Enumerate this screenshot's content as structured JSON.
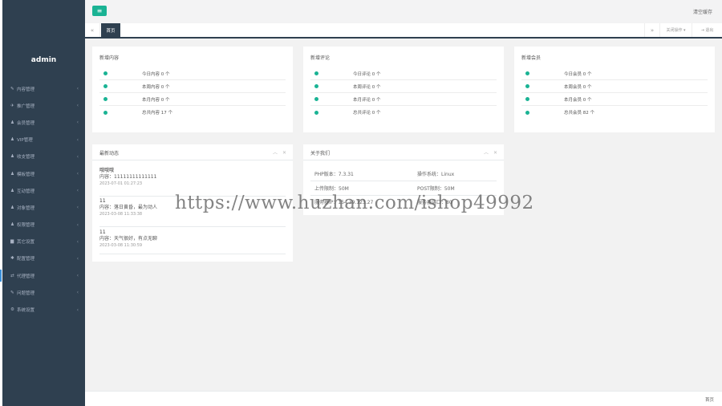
{
  "brand": "admin",
  "sidebar": {
    "items": [
      {
        "icon": "edit-icon",
        "glyph": "✎",
        "label": "内容管理"
      },
      {
        "icon": "send-icon",
        "glyph": "✈",
        "label": "推广管理"
      },
      {
        "icon": "user-icon",
        "glyph": "♟",
        "label": "会员管理"
      },
      {
        "icon": "user-icon",
        "glyph": "♟",
        "label": "VIP管理"
      },
      {
        "icon": "user-icon",
        "glyph": "♟",
        "label": "收支管理"
      },
      {
        "icon": "user-icon",
        "glyph": "♟",
        "label": "模板管理"
      },
      {
        "icon": "user-icon",
        "glyph": "♟",
        "label": "互动管理"
      },
      {
        "icon": "user-icon",
        "glyph": "♟",
        "label": "对象管理"
      },
      {
        "icon": "user-icon",
        "glyph": "♟",
        "label": "权限管理"
      },
      {
        "icon": "book-icon",
        "glyph": "▆",
        "label": "其它设置"
      },
      {
        "icon": "gear-icon",
        "glyph": "✱",
        "label": "配置管理"
      },
      {
        "icon": "exchange-icon",
        "glyph": "⇄",
        "label": "代理管理"
      },
      {
        "icon": "edit-icon",
        "glyph": "✎",
        "label": "问题管理"
      },
      {
        "icon": "gears-icon",
        "glyph": "⚙",
        "label": "系统设置"
      }
    ],
    "arrow": "‹"
  },
  "topbar": {
    "toggle_glyph": "≡",
    "clear_cache": "清空缓存"
  },
  "tabs": {
    "prev": "«",
    "home": "首页",
    "next": "»",
    "close_ops": "关闭操作 ▾",
    "logout": "⇥ 退出"
  },
  "stats": [
    {
      "title": "新增内容",
      "rows": [
        "今日内容 0 个",
        "本周内容 0 个",
        "本月内容 0 个",
        "总共内容 17 个"
      ]
    },
    {
      "title": "新增评论",
      "rows": [
        "今日评论 0 个",
        "本周评论 0 个",
        "本月评论 0 个",
        "总共评论 0 个"
      ]
    },
    {
      "title": "新增会员",
      "rows": [
        "今日会员 0 个",
        "本周会员 0 个",
        "本月会员 0 个",
        "总共会员 82 个"
      ]
    }
  ],
  "news": {
    "title": "最新动态",
    "tools": {
      "collapse": "︿",
      "close": "✕"
    },
    "items": [
      {
        "author": "哦哦哦",
        "content": "内容：11111111111111",
        "time": "2023-07-01 01:27:23"
      },
      {
        "author": "11",
        "content": "内容：落日黄昏，最为动人",
        "time": "2023-03-08 11:33:38"
      },
      {
        "author": "11",
        "content": "内容：天气很好，有点无聊",
        "time": "2023-03-08 11:30:59"
      }
    ]
  },
  "about": {
    "title": "关于我们",
    "tools": {
      "collapse": "︿",
      "close": "✕"
    },
    "php_version": "PHP版本：7.3.31",
    "os": "操作系统：Linux",
    "upload_limit": "上传限制：50M",
    "post_limit": "POST限制：50M",
    "row3_left": "服务器IP：154.39.123.27",
    "row3_right": "服务器端口：80"
  },
  "footer": {
    "text": "首页"
  },
  "watermark": "https://www.huzhan.com/ishop49992"
}
